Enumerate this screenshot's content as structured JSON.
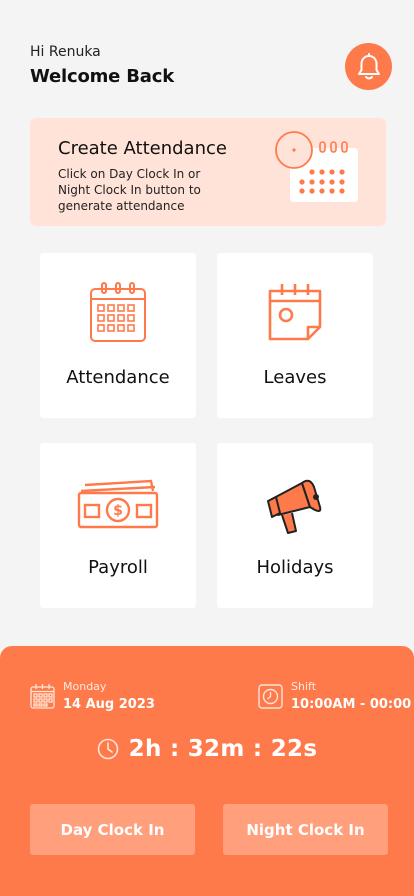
{
  "header": {
    "greeting": "Hi Renuka",
    "title": "Welcome Back",
    "notification_icon": "bell-icon"
  },
  "banner": {
    "title": "Create Attendance",
    "description": "Click on Day Clock In or Night Clock In button to generate attendance",
    "illustration": "calendar-clock-icon"
  },
  "tiles": [
    {
      "label": "Attendance",
      "icon": "attendance-calendar-icon"
    },
    {
      "label": "Leaves",
      "icon": "leave-calendar-icon"
    },
    {
      "label": "Payroll",
      "icon": "money-icon"
    },
    {
      "label": "Holidays",
      "icon": "megaphone-icon"
    }
  ],
  "clock_panel": {
    "day_label": "Monday",
    "date": "14 Aug 2023",
    "shift_label": "Shift",
    "shift_time": "10:00AM - 00:00",
    "elapsed": "2h : 32m : 22s",
    "day_clock_in": "Day Clock In",
    "night_clock_in": "Night Clock In"
  },
  "colors": {
    "accent": "#ff7a4a",
    "banner_bg": "#ffe3d8",
    "button_bg": "#ff9f7c",
    "page_bg": "#f4f4f4"
  }
}
